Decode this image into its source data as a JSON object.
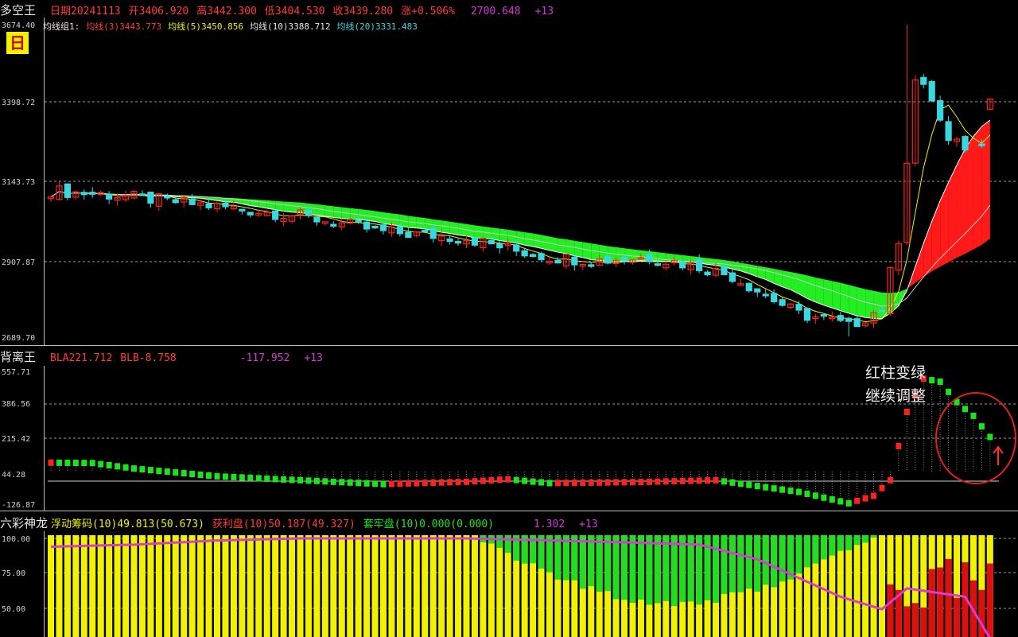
{
  "panel_main": {
    "name": "多空王",
    "date": "日期20241113",
    "open": "开3406.920",
    "high": "高3442.300",
    "low": "低3404.530",
    "close": "收3439.280",
    "change": "涨+0.506%",
    "extra_value": "2700.648",
    "extra_count": "+13",
    "period_icon": "日",
    "ma_group_label": "均线组1:",
    "ma3": "均线(3)3443.773",
    "ma5": "均线(5)3450.856",
    "ma10": "均线(10)3388.712",
    "ma20": "均线(20)3331.483",
    "price_ticks": [
      "3674.40",
      "3398.72",
      "3143.73",
      "2907.87",
      "2689.70"
    ]
  },
  "panel_osc": {
    "name": "背离王",
    "bla": "BLA221.712",
    "blb": "BLB-8.758",
    "value": "-117.952",
    "count": "+13",
    "ticks": [
      "557.71",
      "386.56",
      "215.42",
      "44.28",
      "-126.87"
    ],
    "annotation_line1": "红柱变绿",
    "annotation_line2": "继续调整"
  },
  "panel_chips": {
    "name": "六彩神龙",
    "float": "浮动筹码(10)49.813(50.673)",
    "profit": "获利盘(10)50.187(49.327)",
    "trapped": "套牢盘(10)0.000(0.000)",
    "value": "1.302",
    "count": "+13",
    "ticks": [
      "100.00",
      "75.00",
      "50.00"
    ]
  },
  "colors": {
    "up": "#ff2020",
    "down": "#38d8e0",
    "ribbon_bear": "#22ee22",
    "ribbon_bull": "#ff1a1a",
    "osc_up": "#ff2020",
    "osc_down": "#19e619",
    "chip_yellow": "#f2f200",
    "chip_green": "#22dd22",
    "chip_red": "#dd1010",
    "magenta": "#d83bd8"
  },
  "chart_data": [
    {
      "type": "candlestick",
      "title": "多空王",
      "ylim": [
        2689.7,
        3674.4
      ],
      "x": [
        "day 1",
        "day 114"
      ],
      "candles_key_points": [
        {
          "label": "start",
          "close": 3150
        },
        {
          "label": "low",
          "low": 2689.7
        },
        {
          "label": "spike high",
          "high": 3674.4
        },
        {
          "label": "last",
          "open": 3406.92,
          "high": 3442.3,
          "low": 3404.53,
          "close": 3439.28
        }
      ],
      "moving_averages": [
        {
          "name": "均线(3)",
          "value": 3443.773
        },
        {
          "name": "均线(5)",
          "value": 3450.856
        },
        {
          "name": "均线(10)",
          "value": 3388.712
        },
        {
          "name": "均线(20)",
          "value": 3331.483
        }
      ]
    },
    {
      "type": "bar",
      "title": "背离王",
      "ylim": [
        -126.87,
        557.71
      ],
      "series": [
        {
          "name": "BLA",
          "last": 221.712
        },
        {
          "name": "BLB",
          "last": -8.758
        }
      ]
    },
    {
      "type": "area",
      "title": "六彩神龙",
      "ylim": [
        50,
        100
      ],
      "series": [
        {
          "name": "浮动筹码",
          "last": 49.813
        },
        {
          "name": "获利盘",
          "last": 50.187
        },
        {
          "name": "套牢盘",
          "last": 0.0
        }
      ]
    }
  ]
}
